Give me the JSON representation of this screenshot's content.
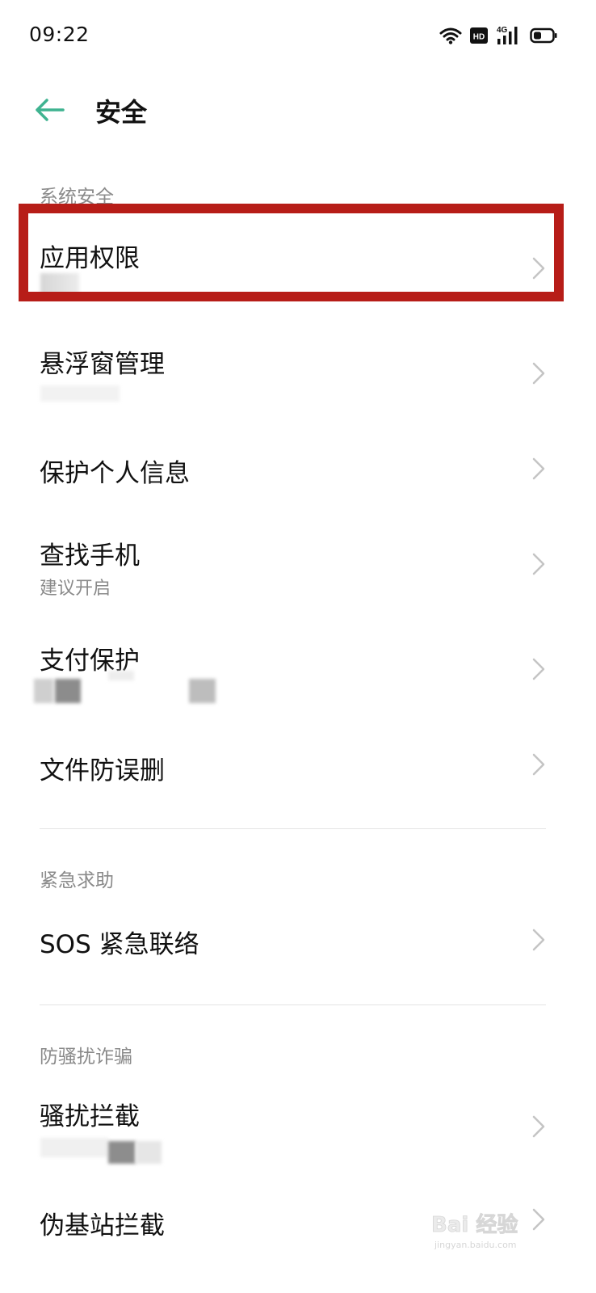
{
  "status_bar": {
    "time": "09:22",
    "icons": [
      "wifi-icon",
      "hd-icon",
      "signal-4g-icon",
      "battery-icon"
    ],
    "hd_label": "HD",
    "network_label": "4G"
  },
  "header": {
    "title": "安全",
    "back_icon": "arrow-left-icon",
    "accent_color": "#3fb390"
  },
  "sections": [
    {
      "header": "系统安全",
      "items": [
        {
          "title": "应用权限",
          "subtitle": ""
        },
        {
          "title": "悬浮窗管理",
          "subtitle": ""
        },
        {
          "title": "保护个人信息",
          "subtitle": ""
        },
        {
          "title": "查找手机",
          "subtitle": "建议开启"
        },
        {
          "title": "支付保护",
          "subtitle": ""
        },
        {
          "title": "文件防误删",
          "subtitle": ""
        }
      ]
    },
    {
      "header": "紧急求助",
      "items": [
        {
          "title": "SOS 紧急联络",
          "subtitle": ""
        }
      ]
    },
    {
      "header": "防骚扰诈骗",
      "items": [
        {
          "title": "骚扰拦截",
          "subtitle": ""
        },
        {
          "title": "伪基站拦截",
          "subtitle": ""
        }
      ]
    }
  ],
  "highlight": {
    "target": "应用权限",
    "color": "#b71d18"
  },
  "watermark": {
    "logo": "Bai 经验",
    "url": "jingyan.baidu.com"
  }
}
